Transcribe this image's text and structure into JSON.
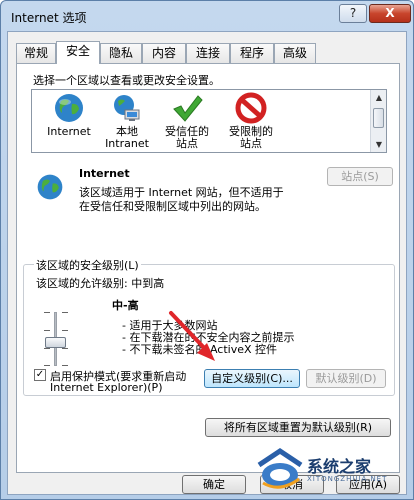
{
  "window": {
    "title": "Internet 选项",
    "help_label": "?",
    "close_label": "X"
  },
  "tabs": [
    {
      "label": "常规"
    },
    {
      "label": "安全"
    },
    {
      "label": "隐私"
    },
    {
      "label": "内容"
    },
    {
      "label": "连接"
    },
    {
      "label": "程序"
    },
    {
      "label": "高级"
    }
  ],
  "active_tab": "安全",
  "security": {
    "instruction": "选择一个区域以查看或更改安全设置。",
    "zones": [
      {
        "line1": "Internet",
        "line2": "",
        "icon": "globe-icon"
      },
      {
        "line1": "本地",
        "line2": "Intranet",
        "icon": "intranet-icon"
      },
      {
        "line1": "受信任的",
        "line2": "站点",
        "icon": "checkmark-icon"
      },
      {
        "line1": "受限制的",
        "line2": "站点",
        "icon": "restricted-icon"
      }
    ],
    "selected_zone": {
      "name": "Internet",
      "description_line1": "该区域适用于 Internet 网站，但不适用于",
      "description_line2": "在受信任和受限制区域中列出的网站。",
      "sites_button": "站点(S)"
    },
    "level_group": {
      "title": "该区域的安全级别(L)",
      "allowed_levels": "该区域的允许级别: 中到高",
      "level_name": "中-高",
      "bullets": [
        "- 适用于大多数网站",
        "- 在下载潜在的不安全内容之前提示",
        "- 不下载未签名的 ActiveX 控件"
      ],
      "protected_mode_line1": "启用保护模式(要求重新启动",
      "protected_mode_line2": "Internet Explorer)(P)",
      "protected_mode_checked": true,
      "custom_level_button": "自定义级别(C)...",
      "default_level_button": "默认级别(D)"
    },
    "reset_all_button": "将所有区域重置为默认级别(R)"
  },
  "footer": {
    "ok_button": "确定",
    "cancel_button": "取消",
    "apply_button": "应用(A)"
  },
  "watermark": {
    "text": "系统之家",
    "sub": "XITONGZHIJIA.NET"
  },
  "colors": {
    "annotation_arrow": "#e0262a",
    "title_bar": "#c4d8ee"
  }
}
